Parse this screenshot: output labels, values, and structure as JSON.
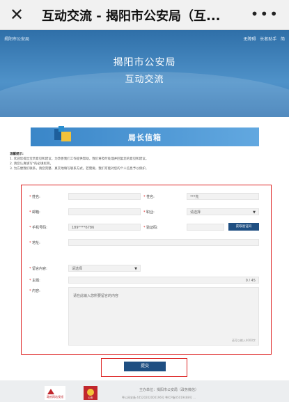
{
  "topbar": {
    "close_glyph": "✕",
    "title": "互动交流 - 揭阳市公安局（互...",
    "more_glyph": "•••"
  },
  "hero": {
    "site_name": "揭阳市公安局",
    "link_accessible": "无障碍",
    "link_elder": "长者助手",
    "link_cut": "简",
    "title_line1": "揭阳市公安局",
    "title_line2": "互动交流"
  },
  "mailbox": {
    "label": "局长信箱"
  },
  "notice": {
    "title": "温馨提示:",
    "lines": [
      "1. 欢迎您提出宝贵意见和建议，为改善我们工作提供帮助，我们将及时处理并回复您的意见和建议。",
      "2. 请您认真填写*的必填栏目。",
      "3. 为方便我们联系，请您完整、真实地填写联系方式。若需要，我们可能对您的个人信息予以保护。"
    ]
  },
  "form": {
    "name_label": "姓名:",
    "name_value": "",
    "surname_label": "性名:",
    "surname_value": "***先",
    "email_label": "邮箱:",
    "email_value": "",
    "job_label": "职业:",
    "job_value": "请选择",
    "phone_label": "手机号码:",
    "phone_value": "189****6786",
    "code_label": "验证码:",
    "code_value": "",
    "code_button": "获取验证码",
    "address_label": "地址:",
    "address_value": "",
    "type_label": "留言内容:",
    "type_value": "请选择",
    "subject_label": "主题:",
    "subject_count": "0 / 45",
    "content_label": "内容:",
    "content_placeholder": "请在此输入您所要留言的内容",
    "content_hint": "还可以输入4000字",
    "submit_label": "提交"
  },
  "footer": {
    "text": "主办单位：揭阳市公安局（政务微信）",
    "sub": "粤公网安备 44520202000196号  粤ICP备05019488号 ...",
    "logo1_text": "政府网站找错",
    "logo2_text": "公安"
  },
  "colors": {
    "accent_dark": "#1f4f82",
    "hero_blue": "#3b7bb6",
    "highlight_red": "#dd2222"
  }
}
